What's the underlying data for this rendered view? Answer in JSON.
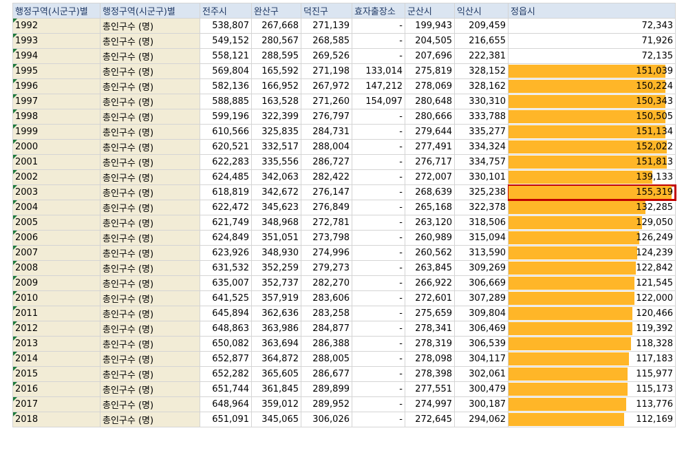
{
  "headers": [
    "행정구역(시군구)별",
    "행정구역(시군구)별",
    "전주시",
    "완산구",
    "덕진구",
    "효자출장소",
    "군산시",
    "익산시",
    "정읍시"
  ],
  "rows": [
    {
      "year": "1992",
      "cat": "총인구수 (명)",
      "vals": [
        "538,807",
        "267,668",
        "271,139",
        "-",
        "199,943",
        "209,459",
        "72,343"
      ],
      "bar": 0
    },
    {
      "year": "1993",
      "cat": "총인구수 (명)",
      "vals": [
        "549,152",
        "280,567",
        "268,585",
        "-",
        "204,505",
        "216,655",
        "71,926"
      ],
      "bar": 0
    },
    {
      "year": "1994",
      "cat": "총인구수 (명)",
      "vals": [
        "558,121",
        "288,595",
        "269,526",
        "-",
        "207,696",
        "222,381",
        "72,135"
      ],
      "bar": 0
    },
    {
      "year": "1995",
      "cat": "총인구수 (명)",
      "vals": [
        "569,804",
        "165,592",
        "271,198",
        "133,014",
        "275,819",
        "328,152",
        "151,039"
      ],
      "bar": 0.96
    },
    {
      "year": "1996",
      "cat": "총인구수 (명)",
      "vals": [
        "582,136",
        "166,952",
        "267,972",
        "147,212",
        "278,069",
        "328,162",
        "150,224"
      ],
      "bar": 0.96
    },
    {
      "year": "1997",
      "cat": "총인구수 (명)",
      "vals": [
        "588,885",
        "163,528",
        "271,260",
        "154,097",
        "280,648",
        "330,310",
        "150,343"
      ],
      "bar": 0.96
    },
    {
      "year": "1998",
      "cat": "총인구수 (명)",
      "vals": [
        "599,196",
        "322,399",
        "276,797",
        "-",
        "280,666",
        "333,788",
        "150,505"
      ],
      "bar": 0.96
    },
    {
      "year": "1999",
      "cat": "총인구수 (명)",
      "vals": [
        "610,566",
        "325,835",
        "284,731",
        "-",
        "279,644",
        "335,277",
        "151,134"
      ],
      "bar": 0.96
    },
    {
      "year": "2000",
      "cat": "총인구수 (명)",
      "vals": [
        "620,521",
        "332,517",
        "288,004",
        "-",
        "277,491",
        "334,324",
        "152,022"
      ],
      "bar": 0.97
    },
    {
      "year": "2001",
      "cat": "총인구수 (명)",
      "vals": [
        "622,283",
        "335,556",
        "286,727",
        "-",
        "276,717",
        "334,757",
        "151,813"
      ],
      "bar": 0.97
    },
    {
      "year": "2002",
      "cat": "총인구수 (명)",
      "vals": [
        "624,485",
        "342,063",
        "282,422",
        "-",
        "272,007",
        "330,101",
        "139,133"
      ],
      "bar": 0.88
    },
    {
      "year": "2003",
      "cat": "총인구수 (명)",
      "vals": [
        "618,819",
        "342,672",
        "276,147",
        "-",
        "268,639",
        "325,238",
        "155,319"
      ],
      "bar": 1.0
    },
    {
      "year": "2004",
      "cat": "총인구수 (명)",
      "vals": [
        "622,472",
        "345,623",
        "276,849",
        "-",
        "265,168",
        "322,378",
        "132,285"
      ],
      "bar": 0.84
    },
    {
      "year": "2005",
      "cat": "총인구수 (명)",
      "vals": [
        "621,749",
        "348,968",
        "272,781",
        "-",
        "263,120",
        "318,506",
        "129,050"
      ],
      "bar": 0.82
    },
    {
      "year": "2006",
      "cat": "총인구수 (명)",
      "vals": [
        "624,849",
        "351,051",
        "273,798",
        "-",
        "260,989",
        "315,094",
        "126,249"
      ],
      "bar": 0.8
    },
    {
      "year": "2007",
      "cat": "총인구수 (명)",
      "vals": [
        "623,926",
        "348,930",
        "274,996",
        "-",
        "260,562",
        "313,590",
        "124,239"
      ],
      "bar": 0.79
    },
    {
      "year": "2008",
      "cat": "총인구수 (명)",
      "vals": [
        "631,532",
        "352,259",
        "279,273",
        "-",
        "263,845",
        "309,269",
        "122,842"
      ],
      "bar": 0.78
    },
    {
      "year": "2009",
      "cat": "총인구수 (명)",
      "vals": [
        "635,007",
        "352,737",
        "282,270",
        "-",
        "266,922",
        "306,669",
        "121,545"
      ],
      "bar": 0.77
    },
    {
      "year": "2010",
      "cat": "총인구수 (명)",
      "vals": [
        "641,525",
        "357,919",
        "283,606",
        "-",
        "272,601",
        "307,289",
        "122,000"
      ],
      "bar": 0.77
    },
    {
      "year": "2011",
      "cat": "총인구수 (명)",
      "vals": [
        "645,894",
        "362,636",
        "283,258",
        "-",
        "275,659",
        "309,804",
        "120,466"
      ],
      "bar": 0.76
    },
    {
      "year": "2012",
      "cat": "총인구수 (명)",
      "vals": [
        "648,863",
        "363,986",
        "284,877",
        "-",
        "278,341",
        "306,469",
        "119,392"
      ],
      "bar": 0.76
    },
    {
      "year": "2013",
      "cat": "총인구수 (명)",
      "vals": [
        "650,082",
        "363,694",
        "286,388",
        "-",
        "278,319",
        "306,539",
        "118,328"
      ],
      "bar": 0.75
    },
    {
      "year": "2014",
      "cat": "총인구수 (명)",
      "vals": [
        "652,877",
        "364,872",
        "288,005",
        "-",
        "278,098",
        "304,117",
        "117,183"
      ],
      "bar": 0.74
    },
    {
      "year": "2015",
      "cat": "총인구수 (명)",
      "vals": [
        "652,282",
        "365,605",
        "286,677",
        "-",
        "278,398",
        "302,061",
        "115,977"
      ],
      "bar": 0.73
    },
    {
      "year": "2016",
      "cat": "총인구수 (명)",
      "vals": [
        "651,744",
        "361,845",
        "289,899",
        "-",
        "277,551",
        "300,479",
        "115,173"
      ],
      "bar": 0.73
    },
    {
      "year": "2017",
      "cat": "총인구수 (명)",
      "vals": [
        "648,964",
        "359,012",
        "289,952",
        "-",
        "274,997",
        "300,187",
        "113,776"
      ],
      "bar": 0.72
    },
    {
      "year": "2018",
      "cat": "총인구수 (명)",
      "vals": [
        "651,091",
        "345,065",
        "306,026",
        "-",
        "272,645",
        "294,062",
        "112,169"
      ],
      "bar": 0.71
    }
  ],
  "selected_row_year": "2003",
  "colors": {
    "data_bar": "#ffb628",
    "selection": "#c00000",
    "header_bg": "#dbe5f1",
    "year_col_bg": "#f2ecd6"
  }
}
